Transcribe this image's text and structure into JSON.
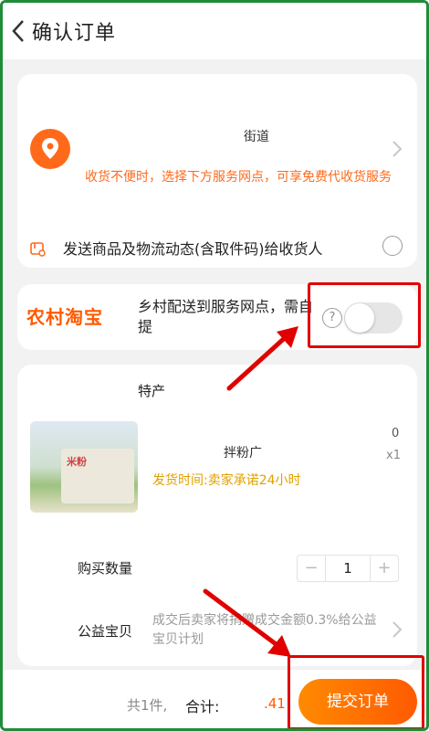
{
  "header": {
    "title": "确认订单"
  },
  "address": {
    "street": "街道",
    "hint": "收货不便时，选择下方服务网点，可享免费代收货服务",
    "notify_label": "发送商品及物流动态(含取件码)给收货人"
  },
  "rural": {
    "logo": "农村淘宝",
    "text": "乡村配送到服务网点，需自提",
    "help_glyph": "?",
    "toggle_on": false
  },
  "goods": {
    "shop_name": "特产",
    "product_title": "拌粉广",
    "product_label": "米粉",
    "price_fragment": "0",
    "quantity": "x1",
    "ship_time": "发货时间:卖家承诺24小时",
    "qty_label": "购买数量",
    "qty_value": "1",
    "minus": "−",
    "plus": "+",
    "charity_label": "公益宝贝",
    "charity_text": "成交后卖家将捐赠成交金额0.3%给公益宝贝计划"
  },
  "footer": {
    "count": "共1件,",
    "total_label": "合计:",
    "total_amount": ".41",
    "submit_label": "提交订单"
  },
  "colors": {
    "accent": "#ff5a00",
    "frame": "#1f8c3a",
    "highlight": "#e00000"
  }
}
